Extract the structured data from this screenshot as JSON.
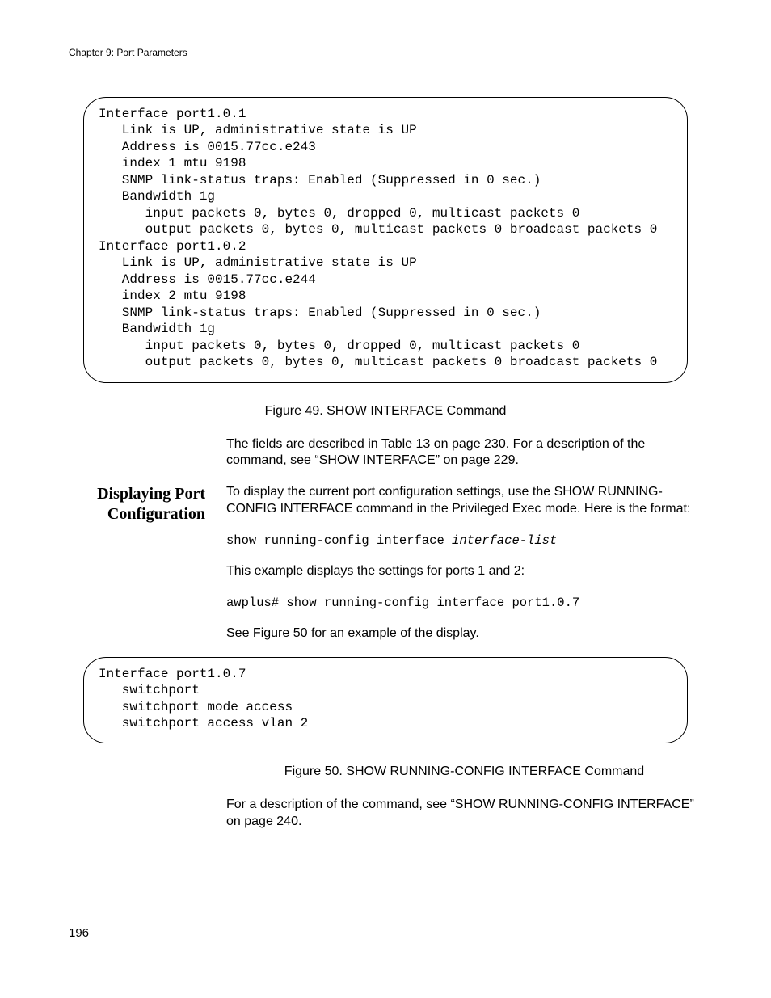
{
  "header": {
    "running": "Chapter 9: Port Parameters"
  },
  "codeblock1": {
    "text": "Interface port1.0.1\n   Link is UP, administrative state is UP\n   Address is 0015.77cc.e243\n   index 1 mtu 9198\n   SNMP link-status traps: Enabled (Suppressed in 0 sec.)\n   Bandwidth 1g\n      input packets 0, bytes 0, dropped 0, multicast packets 0\n      output packets 0, bytes 0, multicast packets 0 broadcast packets 0\nInterface port1.0.2\n   Link is UP, administrative state is UP\n   Address is 0015.77cc.e244\n   index 2 mtu 9198\n   SNMP link-status traps: Enabled (Suppressed in 0 sec.)\n   Bandwidth 1g\n      input packets 0, bytes 0, dropped 0, multicast packets 0\n      output packets 0, bytes 0, multicast packets 0 broadcast packets 0"
  },
  "fig49": {
    "caption": "Figure 49. SHOW INTERFACE Command"
  },
  "para1": "The fields are described in Table 13 on page 230. For a description of the command, see “SHOW INTERFACE” on page 229.",
  "section": {
    "heading": "Displaying Port Configuration",
    "p1": "To display the current port configuration settings, use the SHOW RUNNING-CONFIG INTERFACE command in the Privileged Exec mode. Here is the format:",
    "cmd1_prefix": "show running-config interface ",
    "cmd1_arg": "interface-list",
    "p2": "This example displays the settings for ports 1 and 2:",
    "cmd2": "awplus# show running-config interface port1.0.7",
    "p3": "See Figure 50 for an example of the display."
  },
  "codeblock2": {
    "text": "Interface port1.0.7\n   switchport\n   switchport mode access\n   switchport access vlan 2\n"
  },
  "fig50": {
    "caption": "Figure 50. SHOW RUNNING-CONFIG INTERFACE Command"
  },
  "para2": "For a description of the command, see “SHOW RUNNING-CONFIG INTERFACE” on page 240.",
  "pagenum": "196"
}
